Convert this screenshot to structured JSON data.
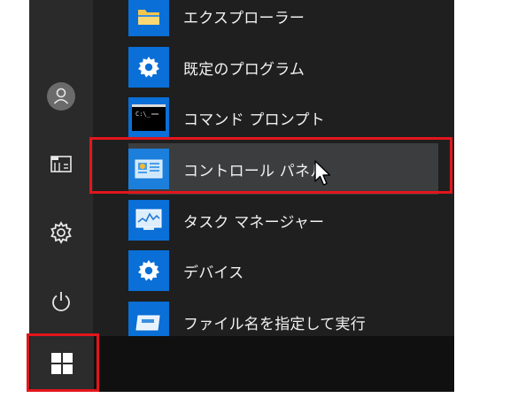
{
  "menu": {
    "apps": [
      {
        "label": "エクスプローラー",
        "icon": "folder-icon"
      },
      {
        "label": "既定のプログラム",
        "icon": "gear-icon"
      },
      {
        "label": "コマンド プロンプト",
        "icon": "command-prompt-icon"
      },
      {
        "label": "コントロール パネル",
        "icon": "control-panel-icon"
      },
      {
        "label": "タスク マネージャー",
        "icon": "task-manager-icon"
      },
      {
        "label": "デバイス",
        "icon": "gear-icon"
      },
      {
        "label": "ファイル名を指定して実行",
        "icon": "run-icon"
      }
    ],
    "rail_icons": [
      "user-avatar-icon",
      "file-explorer-icon",
      "settings-gear-icon",
      "power-icon"
    ]
  },
  "colors": {
    "accent": "#0a6fd6",
    "highlight_frame": "#e2161c",
    "menu_bg": "#1f1f1f"
  }
}
